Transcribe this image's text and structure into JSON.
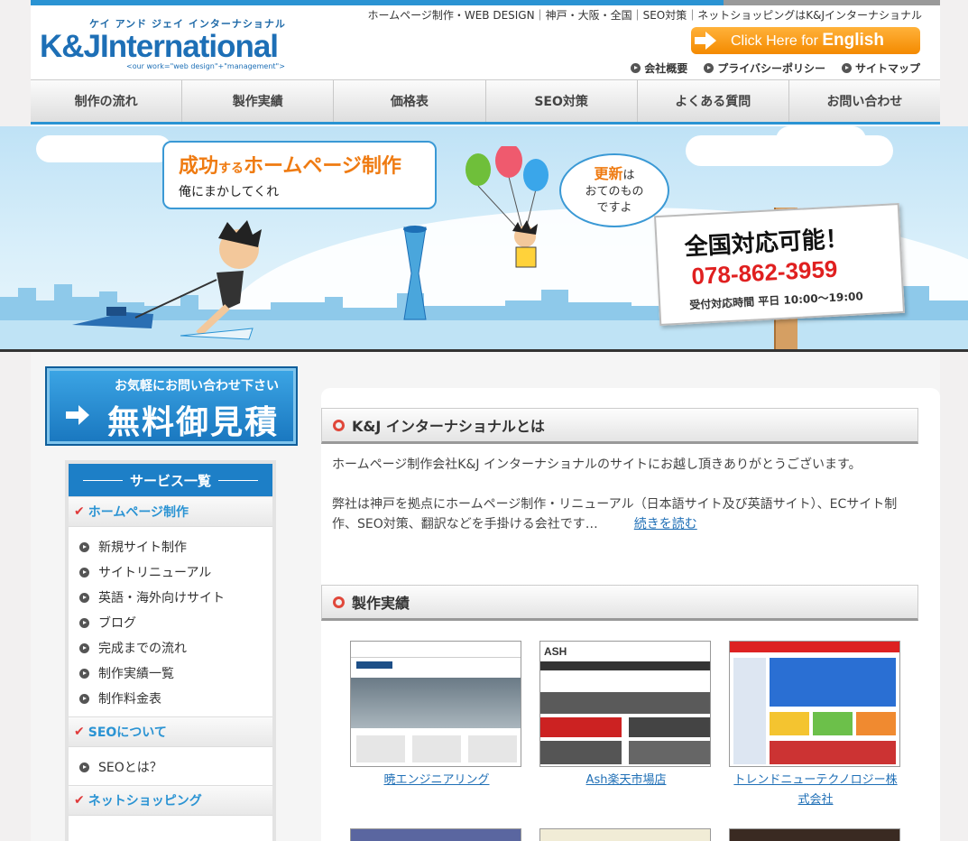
{
  "header": {
    "logo_kana": "ケイ アンド ジェイ インターナショナル",
    "logo_name": "K&JInternational",
    "logo_tag": "<our work=\"web design\"+\"management\">",
    "tagline": "ホームページ制作・WEB DESIGN｜神戸・大阪・全国｜SEO対策｜ネットショッピングはK&Jインターナショナル",
    "english_prefix": "Click Here for",
    "english_word": "English",
    "sublinks": [
      "会社概要",
      "プライバシーポリシー",
      "サイトマップ"
    ]
  },
  "nav": [
    "制作の流れ",
    "製作実績",
    "価格表",
    "SEO対策",
    "よくある質問",
    "お問い合わせ"
  ],
  "hero": {
    "bubble1_big": "成功",
    "bubble1_small": "する",
    "bubble1_rest": "ホームページ制作",
    "bubble1_sub": "俺にまかしてくれ",
    "bubble2_hl": "更新",
    "bubble2_a": "は",
    "bubble2_b": "おてのもの",
    "bubble2_c": "ですよ",
    "sign_title": "全国対応可能！",
    "sign_phone": "078-862-3959",
    "sign_hours": "受付対応時間 平日 10:00〜19:00"
  },
  "estimate": {
    "small": "お気軽にお問い合わせ下さい",
    "big": "無料御見積"
  },
  "sidebar": {
    "heading": "サービス一覧",
    "cat_hp": "ホームページ制作",
    "hp_items": [
      "新規サイト制作",
      "サイトリニューアル",
      "英語・海外向けサイト",
      "ブログ",
      "完成までの流れ",
      "制作実績一覧",
      "制作料金表"
    ],
    "cat_seo": "SEOについて",
    "seo_items": [
      "SEOとは？"
    ],
    "cat_shop": "ネットショッピング"
  },
  "about": {
    "title": "K&J インターナショナルとは",
    "p1": "ホームページ制作会社K&J インターナショナルのサイトにお越し頂きありがとうございます。",
    "p2": "弊社は神戸を拠点にホームページ制作・リニューアル（日本語サイト及び英語サイト）、ECサイト制作、SEO対策、翻訳などを手掛ける会社です…",
    "readmore": "続きを読む"
  },
  "works": {
    "title": "製作実績",
    "items": [
      "暁エンジニアリング",
      "Ash楽天市場店",
      "トレンドニューテクノロジー株式会社"
    ]
  },
  "colors": {
    "primary_blue": "#1d7fc7",
    "accent_orange": "#f48a00",
    "alert_red": "#e02020"
  }
}
